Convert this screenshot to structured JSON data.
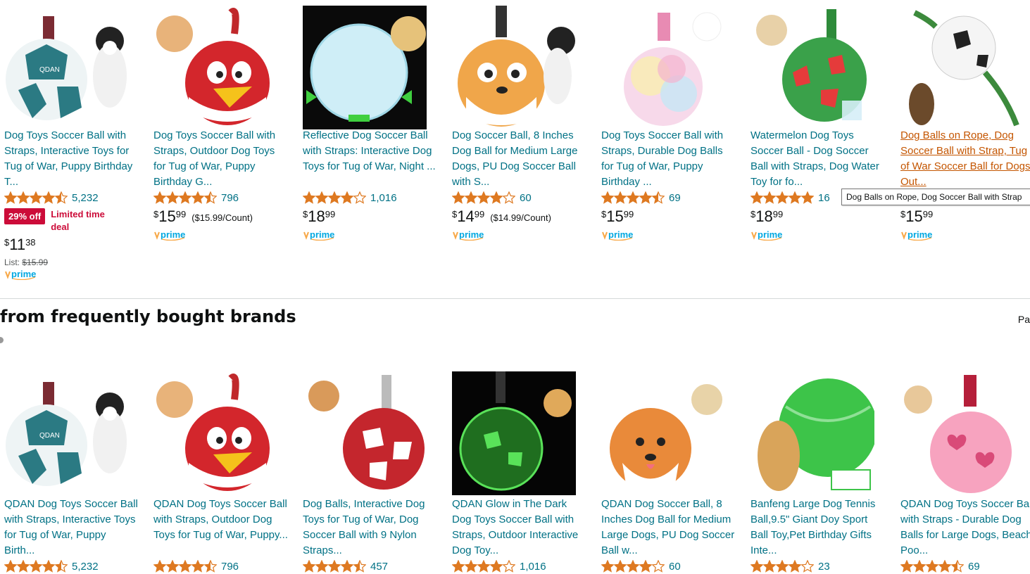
{
  "row1": [
    {
      "title": "Dog Toys Soccer Ball with Straps, Interactive Toys for Tug of War, Puppy Birthday T...",
      "stars": 4.5,
      "count": "5,232",
      "deal_badge": "29% off",
      "deal_text": "Limited time deal",
      "price_sym": "$",
      "price_whole": "11",
      "price_frac": "38",
      "unit_price": "",
      "list_label": "List:",
      "list_price": "$15.99",
      "prime": true,
      "image_icon": "soccer-ball-teal-dog-image"
    },
    {
      "title": "Dog Toys Soccer Ball with Straps, Outdoor Dog Toys for Tug of War, Puppy Birthday G...",
      "stars": 4.5,
      "count": "796",
      "price_sym": "$",
      "price_whole": "15",
      "price_frac": "99",
      "unit_price": "($15.99/Count)",
      "prime": true,
      "image_icon": "red-bird-ball-image"
    },
    {
      "title": "Reflective Dog Soccer Ball with Straps: Interactive Dog Toys for Tug of War, Night ...",
      "stars": 4.0,
      "count": "1,016",
      "price_sym": "$",
      "price_whole": "18",
      "price_frac": "99",
      "unit_price": "",
      "prime": true,
      "image_icon": "reflective-ball-image"
    },
    {
      "title": "Dog Soccer Ball, 8 Inches Dog Ball for Medium Large Dogs, PU Dog Soccer Ball with S...",
      "stars": 4.0,
      "count": "60",
      "price_sym": "$",
      "price_whole": "14",
      "price_frac": "99",
      "unit_price": "($14.99/Count)",
      "prime": true,
      "image_icon": "leopard-ball-image"
    },
    {
      "title": "Dog Toys Soccer Ball with Straps, Durable Dog Balls for Tug of War, Puppy Birthday ...",
      "stars": 4.5,
      "count": "69",
      "price_sym": "$",
      "price_whole": "15",
      "price_frac": "99",
      "unit_price": "",
      "prime": true,
      "image_icon": "tie-dye-ball-image"
    },
    {
      "title": "Watermelon Dog Toys Soccer Ball - Dog Soccer Ball with Straps, Dog Water Toy for fo...",
      "stars": 5.0,
      "count": "16",
      "price_sym": "$",
      "price_whole": "18",
      "price_frac": "99",
      "unit_price": "",
      "prime": true,
      "image_icon": "watermelon-ball-image"
    },
    {
      "title": "Dog Balls on Rope, Dog Soccer Ball with Strap, Tug of War Soccer Ball for Dogs, Out...",
      "stars": 0,
      "count": "",
      "price_sym": "$",
      "price_whole": "15",
      "price_frac": "99",
      "unit_price": "",
      "prime": true,
      "image_icon": "rope-ball-image",
      "hover": true
    }
  ],
  "tooltip": "Dog Balls on Rope, Dog Soccer Ball with Strap",
  "section": {
    "heading": "from frequently bought brands",
    "page_indicator": "Pa"
  },
  "row2": [
    {
      "title": "QDAN Dog Toys Soccer Ball with Straps, Interactive Toys for Tug of War, Puppy Birth...",
      "stars": 4.5,
      "count": "5,232",
      "image_icon": "soccer-ball-teal-dog-image"
    },
    {
      "title": "QDAN Dog Toys Soccer Ball with Straps, Outdoor Dog Toys for Tug of War, Puppy...",
      "stars": 4.5,
      "count": "796",
      "image_icon": "red-bird-ball-image"
    },
    {
      "title": "Dog Balls, Interactive Dog Toys for Tug of War, Dog Soccer Ball with 9 Nylon Straps...",
      "stars": 4.5,
      "count": "457",
      "image_icon": "paw-ball-image"
    },
    {
      "title": "QDAN Glow in The Dark Dog Toys Soccer Ball with Straps, Outdoor Interactive Dog Toy...",
      "stars": 4.0,
      "count": "1,016",
      "image_icon": "glow-ball-image"
    },
    {
      "title": "QDAN Dog Soccer Ball, 8 Inches Dog Ball for Medium Large Dogs, PU Dog Soccer Ball w...",
      "stars": 4.0,
      "count": "60",
      "image_icon": "corgi-ball-image"
    },
    {
      "title": "Banfeng Large Dog Tennis Ball,9.5\" Giant Doy Sport Ball Toy,Pet Birthday Gifts Inte...",
      "stars": 4.0,
      "count": "23",
      "image_icon": "tennis-ball-image"
    },
    {
      "title": "QDAN Dog Toys Soccer Ball with Straps - Durable Dog Balls for Large Dogs, Beach Poo...",
      "stars": 4.5,
      "count": "69",
      "image_icon": "pink-heart-ball-image"
    }
  ],
  "colors": {
    "link": "#007185",
    "deal": "#cc0c39",
    "star": "#de7921",
    "prime": "#00a8e1"
  },
  "prime_label": "prime"
}
